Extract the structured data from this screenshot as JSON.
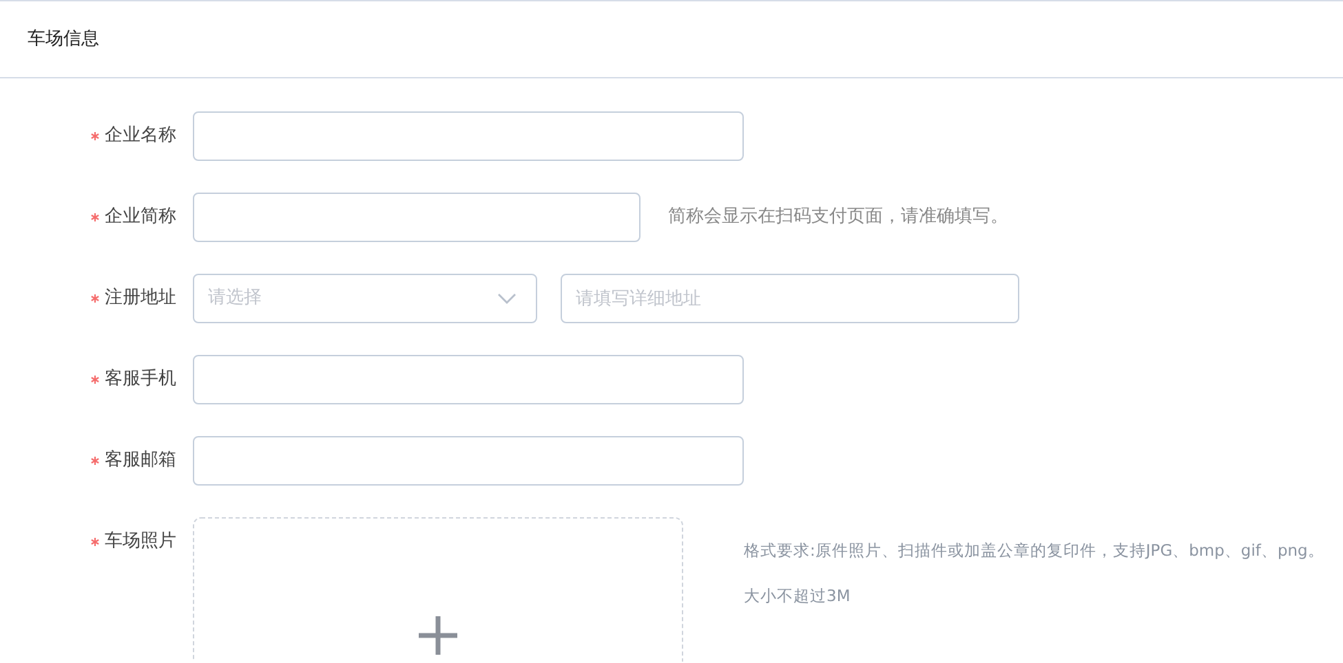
{
  "panel": {
    "title": "车场信息"
  },
  "fields": [
    {
      "kind": "input",
      "label": "企业名称",
      "required": true
    },
    {
      "kind": "input",
      "label": "企业简称",
      "required": true,
      "hint": "简称会显示在扫码支付页面，请准确填写。"
    },
    {
      "kind": "address",
      "label": "注册地址",
      "required": true,
      "select_placeholder": "请选择",
      "placeholder": "请填写详细地址"
    },
    {
      "kind": "input",
      "label": "客服手机",
      "required": true
    },
    {
      "kind": "input",
      "label": "客服邮箱",
      "required": true
    },
    {
      "kind": "upload",
      "label": "车场照片",
      "required": true,
      "notes": [
        "格式要求:原件照片、扫描件或加盖公章的复印件，支持JPG、bmp、gif、png。",
        "大小不超过3M"
      ]
    }
  ]
}
